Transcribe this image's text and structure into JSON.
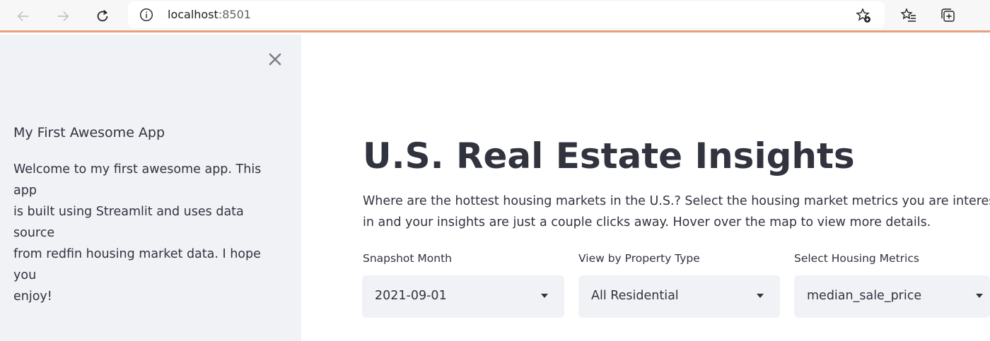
{
  "browser": {
    "url_host": "localhost",
    "url_port": ":8501",
    "icons": [
      "back-arrow-icon",
      "forward-arrow-icon",
      "reload-icon",
      "info-icon",
      "add-favorite-icon",
      "favorites-icon",
      "collections-icon"
    ]
  },
  "sidebar": {
    "title": "My First Awesome App",
    "line1": "Welcome to my first awesome app. This app",
    "line2": "is built using Streamlit and uses data source",
    "line3": "from redfin housing market data. I hope you",
    "line4": "enjoy!"
  },
  "main": {
    "title": "U.S. Real Estate Insights",
    "desc_line1": "Where are the hottest housing markets in the U.S.? Select the housing market metrics you are interested",
    "desc_line2": "in and your insights are just a couple clicks away. Hover over the map to view more details."
  },
  "selects": [
    {
      "label": "Snapshot Month",
      "value": "2021-09-01"
    },
    {
      "label": "View by Property Type",
      "value": "All Residential"
    },
    {
      "label": "Select Housing Metrics",
      "value": "median_sale_price"
    }
  ],
  "colors": {
    "sidebar_bg": "#f0f2f6",
    "text": "#31333f",
    "accent_line": "#e8a07a"
  }
}
